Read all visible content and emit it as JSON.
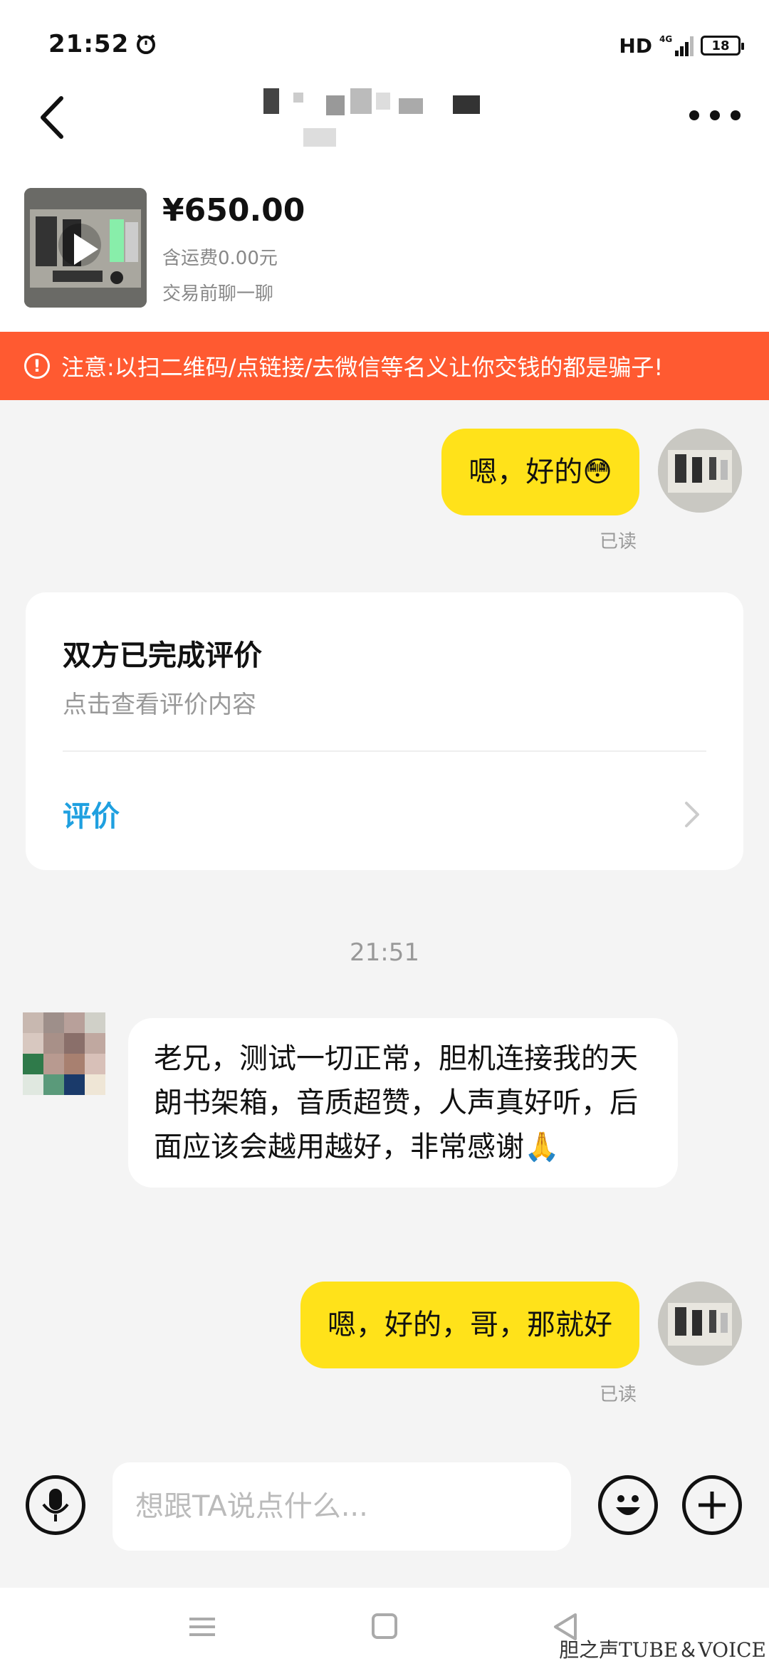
{
  "status": {
    "time": "21:52",
    "network": "HD",
    "network_gen": "4G",
    "battery": "18"
  },
  "header": {
    "back_icon": "back-chevron-icon",
    "more_icon": "more-dots-icon"
  },
  "product": {
    "price": "¥650.00",
    "shipping": "含运费0.00元",
    "chat_hint": "交易前聊一聊"
  },
  "warning": {
    "icon": "!",
    "text": "注意:以扫二维码/点链接/去微信等名义让你交钱的都是骗子!"
  },
  "messages": [
    {
      "from": "me",
      "text": "嗯，好的😳",
      "status": "已读"
    },
    {
      "from": "other",
      "text": "老兄，测试一切正常，胆机连接我的天朗书架箱，音质超赞，人声真好听，后面应该会越用越好，非常感谢🙏"
    },
    {
      "from": "me",
      "text": "嗯，好的，哥，那就好",
      "status": "已读"
    }
  ],
  "review_card": {
    "title": "双方已完成评价",
    "subtitle": "点击查看评价内容",
    "link": "评价"
  },
  "timestamp": "21:51",
  "input": {
    "placeholder": "想跟TA说点什么..."
  },
  "watermark": "胆之声TUBE＆VOICE",
  "colors": {
    "accent_yellow": "#ffe21a",
    "warning_red": "#ff5a31",
    "link_blue": "#1fa0e0"
  }
}
